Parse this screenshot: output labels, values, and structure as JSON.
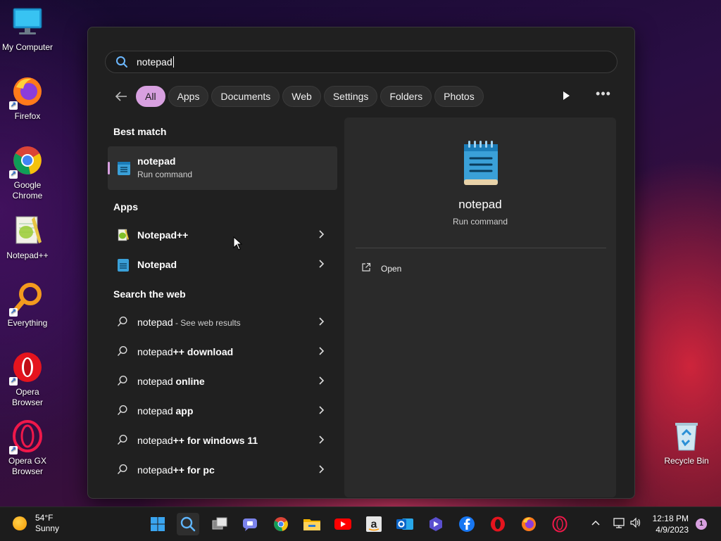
{
  "desktop": {
    "icons": [
      {
        "label": "My Computer"
      },
      {
        "label": "Firefox"
      },
      {
        "label": "Google Chrome"
      },
      {
        "label": "Notepad++"
      },
      {
        "label": "Everything"
      },
      {
        "label": "Opera Browser"
      },
      {
        "label": "Opera GX Browser"
      },
      {
        "label": "Recycle Bin"
      }
    ]
  },
  "search": {
    "query": "notepad",
    "filters": [
      "All",
      "Apps",
      "Documents",
      "Web",
      "Settings",
      "Folders",
      "Photos"
    ],
    "active_filter": "All"
  },
  "results": {
    "best_match_heading": "Best match",
    "best_match": {
      "title": "notepad",
      "subtitle": "Run command"
    },
    "apps_heading": "Apps",
    "apps": [
      {
        "label": "Notepad++"
      },
      {
        "label": "Notepad"
      }
    ],
    "web_heading": "Search the web",
    "web": [
      {
        "prefix": "notepad",
        "bold": "",
        "suffix": " - See web results"
      },
      {
        "prefix": "notepad",
        "bold": "++ download",
        "suffix": ""
      },
      {
        "prefix": "notepad",
        "bold": " online",
        "suffix": ""
      },
      {
        "prefix": "notepad",
        "bold": " app",
        "suffix": ""
      },
      {
        "prefix": "notepad",
        "bold": "++ for windows 11",
        "suffix": ""
      },
      {
        "prefix": "notepad",
        "bold": "++ for pc",
        "suffix": ""
      }
    ]
  },
  "preview": {
    "title": "notepad",
    "subtitle": "Run command",
    "action": "Open"
  },
  "taskbar": {
    "weather_temp": "54°F",
    "weather_desc": "Sunny",
    "time": "12:18 PM",
    "date": "4/9/2023",
    "notification_count": "1",
    "apps": [
      "start-icon",
      "search-icon",
      "task-view-icon",
      "chat-icon",
      "chrome-icon",
      "file-explorer-icon",
      "youtube-icon",
      "amazon-icon",
      "outlook-icon",
      "clipchamp-icon",
      "facebook-icon",
      "opera-icon",
      "firefox-icon",
      "opera-gx-icon"
    ]
  },
  "colors": {
    "accent": "#d8a0e0",
    "panel_bg": "#202020",
    "preview_bg": "#2a2a2a"
  }
}
